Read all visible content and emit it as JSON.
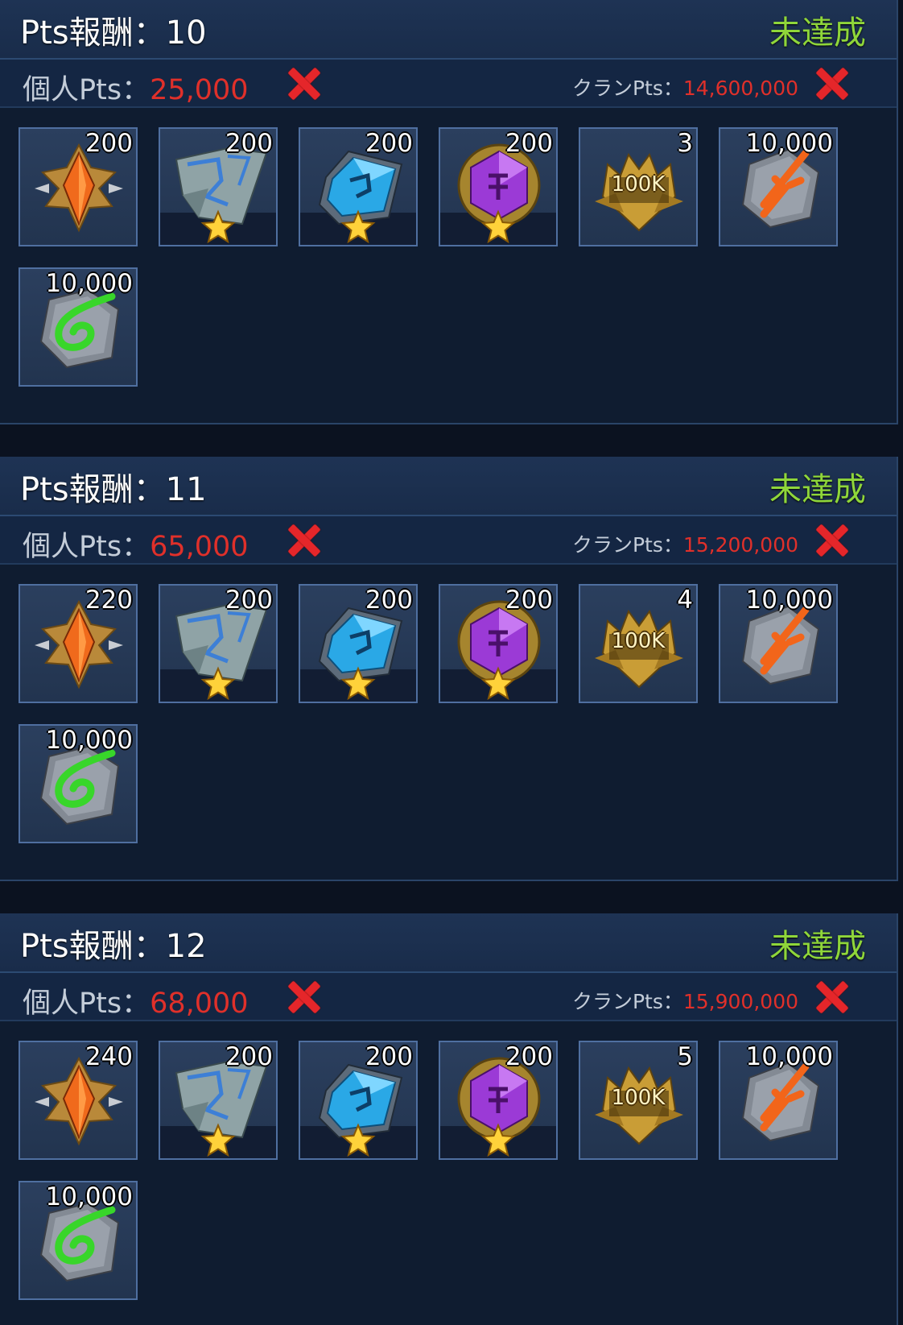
{
  "tiers": [
    {
      "title": "Pts報酬：10",
      "status": "未達成",
      "personal_label": "個人Pts：",
      "personal_value": "25,000",
      "clan_label": "クランPts：",
      "clan_value": "14,600,000",
      "items": [
        {
          "icon": "orange-gem-medal-icon",
          "qty": "200"
        },
        {
          "icon": "silver-ore-shard-icon",
          "qty": "200",
          "star": true
        },
        {
          "icon": "blue-gem-crystal-icon",
          "qty": "200",
          "star": true
        },
        {
          "icon": "purple-rune-coin-icon",
          "qty": "200",
          "star": true
        },
        {
          "icon": "gold-100k-emblem-icon",
          "qty": "3",
          "emblem_text": "100K"
        },
        {
          "icon": "red-rune-stone-icon",
          "qty": "10,000"
        },
        {
          "icon": "green-rune-stone-icon",
          "qty": "10,000"
        }
      ]
    },
    {
      "title": "Pts報酬：11",
      "status": "未達成",
      "personal_label": "個人Pts：",
      "personal_value": "65,000",
      "clan_label": "クランPts：",
      "clan_value": "15,200,000",
      "items": [
        {
          "icon": "orange-gem-medal-icon",
          "qty": "220"
        },
        {
          "icon": "silver-ore-shard-icon",
          "qty": "200",
          "star": true
        },
        {
          "icon": "blue-gem-crystal-icon",
          "qty": "200",
          "star": true
        },
        {
          "icon": "purple-rune-coin-icon",
          "qty": "200",
          "star": true
        },
        {
          "icon": "gold-100k-emblem-icon",
          "qty": "4",
          "emblem_text": "100K"
        },
        {
          "icon": "red-rune-stone-icon",
          "qty": "10,000"
        },
        {
          "icon": "green-rune-stone-icon",
          "qty": "10,000"
        }
      ]
    },
    {
      "title": "Pts報酬：12",
      "status": "未達成",
      "personal_label": "個人Pts：",
      "personal_value": "68,000",
      "clan_label": "クランPts：",
      "clan_value": "15,900,000",
      "items": [
        {
          "icon": "orange-gem-medal-icon",
          "qty": "240"
        },
        {
          "icon": "silver-ore-shard-icon",
          "qty": "200",
          "star": true
        },
        {
          "icon": "blue-gem-crystal-icon",
          "qty": "200",
          "star": true
        },
        {
          "icon": "purple-rune-coin-icon",
          "qty": "200",
          "star": true
        },
        {
          "icon": "gold-100k-emblem-icon",
          "qty": "5",
          "emblem_text": "100K"
        },
        {
          "icon": "red-rune-stone-icon",
          "qty": "10,000"
        },
        {
          "icon": "green-rune-stone-icon",
          "qty": "10,000"
        }
      ]
    }
  ]
}
